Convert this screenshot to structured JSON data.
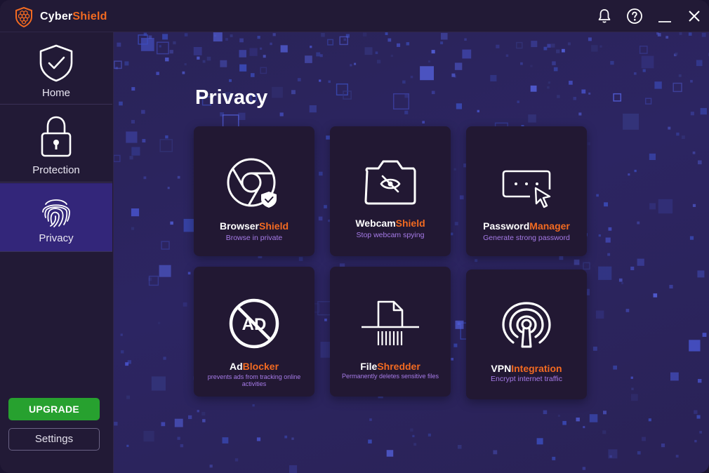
{
  "app": {
    "name_part1": "Cyber",
    "name_part2": "Shield",
    "accent_color": "#f26a21",
    "upgrade_color": "#27a12f"
  },
  "titlebar": {
    "icons": [
      "bell-icon",
      "help-icon",
      "minimize-icon",
      "close-icon"
    ]
  },
  "sidebar": {
    "items": [
      {
        "label": "Home",
        "icon": "shield-check-icon"
      },
      {
        "label": "Protection",
        "icon": "padlock-icon"
      },
      {
        "label": "Privacy",
        "icon": "fingerprint-icon",
        "active": true
      }
    ],
    "upgrade_label": "UPGRADE",
    "settings_label": "Settings"
  },
  "main": {
    "title": "Privacy",
    "cards": [
      {
        "title_a": "Browser",
        "title_b": "Shield",
        "subtitle": "Browse in private",
        "icon": "browser-shield-icon"
      },
      {
        "title_a": "Webcam",
        "title_b": "Shield",
        "subtitle": "Stop webcam spying",
        "icon": "webcam-off-icon"
      },
      {
        "title_a": "Password",
        "title_b": "Manager",
        "subtitle": "Generate strong password",
        "icon": "password-field-icon"
      },
      {
        "title_a": "Ad",
        "title_b": "Blocker",
        "subtitle": "prevents ads from tracking online activities",
        "icon": "ad-block-icon"
      },
      {
        "title_a": "File",
        "title_b": "Shredder",
        "subtitle": "Permanently deletes sensitive files",
        "icon": "file-shredder-icon"
      },
      {
        "title_a": "VPN",
        "title_b": "Integration",
        "subtitle": "Encrypt internet traffic",
        "icon": "vpn-keyhole-icon"
      }
    ]
  }
}
